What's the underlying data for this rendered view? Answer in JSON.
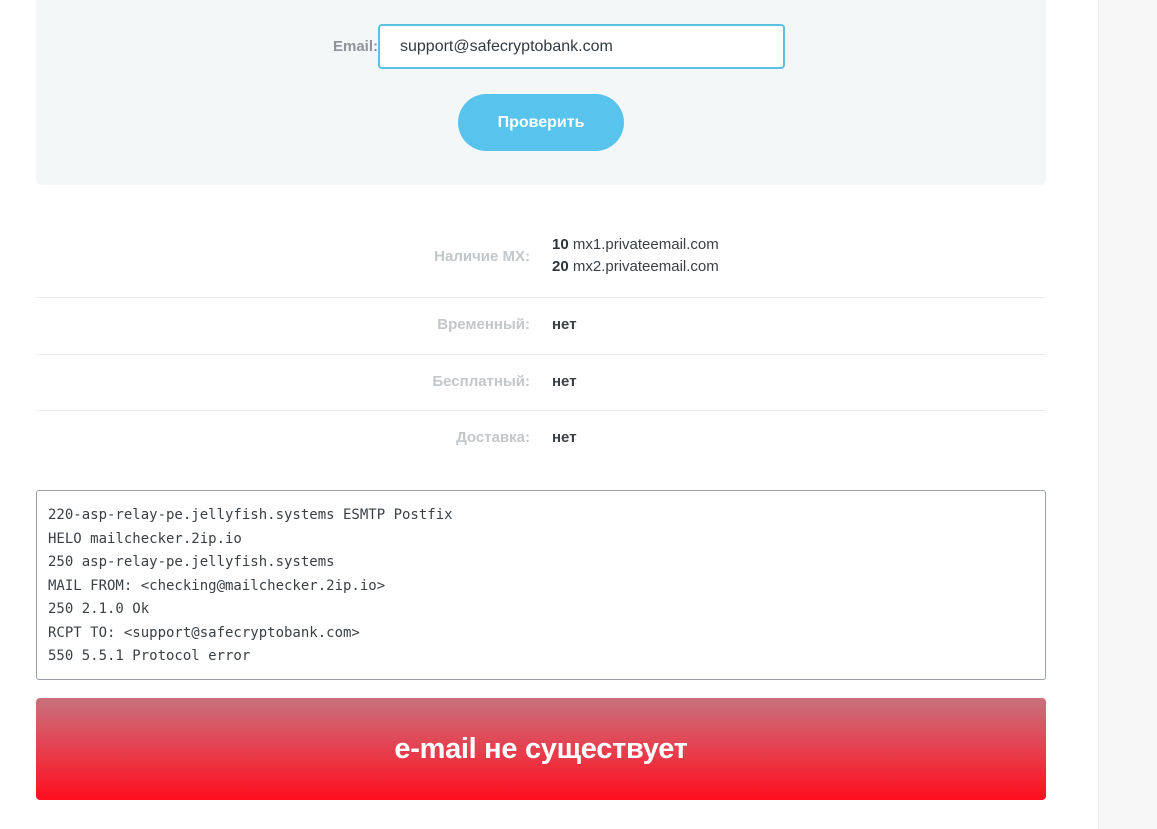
{
  "form": {
    "email_label": "Email:",
    "email_value": "support@safecryptobank.com",
    "check_button_label": "Проверить"
  },
  "results": {
    "mx": {
      "label": "Наличие MX:",
      "records": [
        {
          "priority": "10",
          "host": "mx1.privateemail.com"
        },
        {
          "priority": "20",
          "host": "mx2.privateemail.com"
        }
      ]
    },
    "temporary": {
      "label": "Временный:",
      "value": "нет"
    },
    "free": {
      "label": "Бесплатный:",
      "value": "нет"
    },
    "delivery": {
      "label": "Доставка:",
      "value": "нет"
    }
  },
  "smtp_log": [
    "220-asp-relay-pe.jellyfish.systems ESMTP Postfix",
    "HELO mailchecker.2ip.io",
    "250 asp-relay-pe.jellyfish.systems",
    "MAIL FROM: <checking@mailchecker.2ip.io>",
    "250 2.1.0 Ok",
    "RCPT TO: <support@safecryptobank.com>",
    "550 5.5.1 Protocol error"
  ],
  "verdict": {
    "text": "e-mail не существует",
    "color_top": "#c7727c",
    "color_bottom": "#ff0e1f"
  },
  "colors": {
    "accent": "#58c3ec",
    "input_border": "#5bc0e1",
    "panel_bg": "#f4f7f8"
  }
}
